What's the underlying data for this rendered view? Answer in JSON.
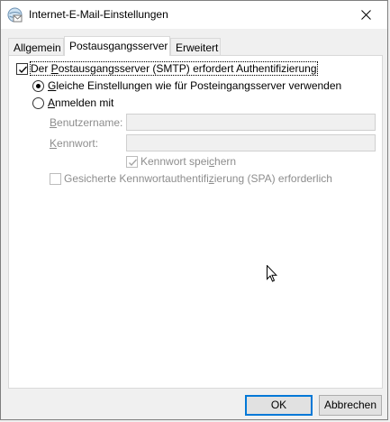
{
  "window": {
    "title": "Internet-E-Mail-Einstellungen"
  },
  "tabs": [
    {
      "label": "Allgemein",
      "active": false
    },
    {
      "label": "Postausgangsserver",
      "active": true
    },
    {
      "label": "Erweitert",
      "active": false
    }
  ],
  "smtp_auth": {
    "checkbox": {
      "checked": true,
      "pre": "Der ",
      "accel": "P",
      "post": "ostausgangsserver (SMTP) erfordert Authentifizierung"
    },
    "same_settings": {
      "selected": true,
      "accel": "G",
      "post": "leiche Einstellungen wie für Posteingangsserver verwenden"
    },
    "login_with": {
      "selected": false,
      "accel": "A",
      "post": "nmelden mit"
    },
    "username": {
      "accel": "B",
      "post": "enutzername:",
      "value": ""
    },
    "password": {
      "accel": "K",
      "post": "ennwort:",
      "value": ""
    },
    "save_password": {
      "checked": true,
      "pre": "Kennwort spei",
      "accel": "c",
      "post": "hern"
    },
    "spa": {
      "checked": false,
      "pre": "Gesicherte Kennwortauthentifi",
      "accel": "z",
      "post": "ierung (SPA) erforderlich"
    }
  },
  "buttons": {
    "ok": "OK",
    "cancel": "Abbrechen"
  }
}
